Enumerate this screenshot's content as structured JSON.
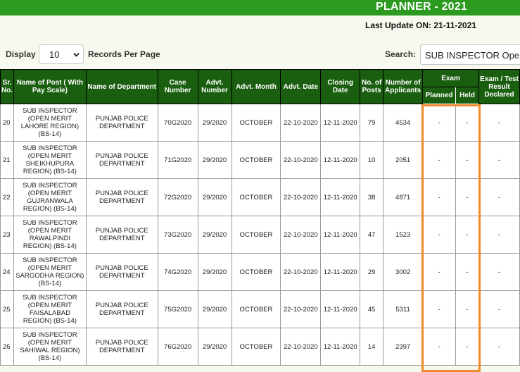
{
  "header": {
    "title": "PLANNER - 2021",
    "last_update": "Last Update ON: 21-11-2021"
  },
  "controls": {
    "display_label": "Display",
    "display_value": "10",
    "records_label": "Records Per Page",
    "search_label": "Search:",
    "search_value": "SUB INSPECTOR Ope"
  },
  "table": {
    "headers": {
      "sr": "Sr. No.",
      "post": "Name of Post ( With Pay Scale)",
      "department": "Name of Department",
      "case": "Case Number",
      "advt_number": "Advt. Number",
      "advt_month": "Advt. Month",
      "advt_date": "Advt. Date",
      "closing": "Closing Date",
      "posts": "No. of Posts",
      "applicants": "Number of Applicants",
      "exam": "Exam",
      "planned": "Planned",
      "held": "Held",
      "result": "Exam / Test Result Declared"
    },
    "rows": [
      {
        "sr": "20",
        "post": "SUB INSPECTOR (OPEN MERIT LAHORE REGION) (BS-14)",
        "department": "PUNJAB POLICE DEPARTMENT",
        "case": "70G2020",
        "advt_number": "29/2020",
        "advt_month": "OCTOBER",
        "advt_date": "22-10-2020",
        "closing": "12-11-2020",
        "posts": "79",
        "applicants": "4534",
        "planned": "-",
        "held": "-",
        "result": "-"
      },
      {
        "sr": "21",
        "post": "SUB INSPECTOR (OPEN MERIT SHEIKHUPURA REGION) (BS-14)",
        "department": "PUNJAB POLICE DEPARTMENT",
        "case": "71G2020",
        "advt_number": "29/2020",
        "advt_month": "OCTOBER",
        "advt_date": "22-10-2020",
        "closing": "12-11-2020",
        "posts": "10",
        "applicants": "2051",
        "planned": "-",
        "held": "-",
        "result": "-"
      },
      {
        "sr": "22",
        "post": "SUB INSPECTOR (OPEN MERIT GUJRANWALA REGION) (BS-14)",
        "department": "PUNJAB POLICE DEPARTMENT",
        "case": "72G2020",
        "advt_number": "29/2020",
        "advt_month": "OCTOBER",
        "advt_date": "22-10-2020",
        "closing": "12-11-2020",
        "posts": "38",
        "applicants": "4871",
        "planned": "-",
        "held": "-",
        "result": "-"
      },
      {
        "sr": "23",
        "post": "SUB INSPECTOR (OPEN MERIT RAWALPINDI REGION) (BS-14)",
        "department": "PUNJAB POLICE DEPARTMENT",
        "case": "73G2020",
        "advt_number": "29/2020",
        "advt_month": "OCTOBER",
        "advt_date": "22-10-2020",
        "closing": "12-11-2020",
        "posts": "47",
        "applicants": "1523",
        "planned": "-",
        "held": "-",
        "result": "-"
      },
      {
        "sr": "24",
        "post": "SUB INSPECTOR (OPEN MERIT SARGODHA REGION) (BS-14)",
        "department": "PUNJAB POLICE DEPARTMENT",
        "case": "74G2020",
        "advt_number": "29/2020",
        "advt_month": "OCTOBER",
        "advt_date": "22-10-2020",
        "closing": "12-11-2020",
        "posts": "29",
        "applicants": "3002",
        "planned": "-",
        "held": "-",
        "result": "-"
      },
      {
        "sr": "25",
        "post": "SUB INSPECTOR (OPEN MERIT FAISALABAD REGION) (BS-14)",
        "department": "PUNJAB POLICE DEPARTMENT",
        "case": "75G2020",
        "advt_number": "29/2020",
        "advt_month": "OCTOBER",
        "advt_date": "22-10-2020",
        "closing": "12-11-2020",
        "posts": "45",
        "applicants": "5311",
        "planned": "-",
        "held": "-",
        "result": "-"
      },
      {
        "sr": "26",
        "post": "SUB INSPECTOR (OPEN MERIT SAHIWAL REGION) (BS-14)",
        "department": "PUNJAB POLICE DEPARTMENT",
        "case": "76G2020",
        "advt_number": "29/2020",
        "advt_month": "OCTOBER",
        "advt_date": "22-10-2020",
        "closing": "12-11-2020",
        "posts": "14",
        "applicants": "2397",
        "planned": "-",
        "held": "-",
        "result": "-"
      }
    ]
  },
  "colors": {
    "header_bar": "#2b9a1f",
    "table_header": "#1a5e0f",
    "highlight": "#f08a2b"
  }
}
